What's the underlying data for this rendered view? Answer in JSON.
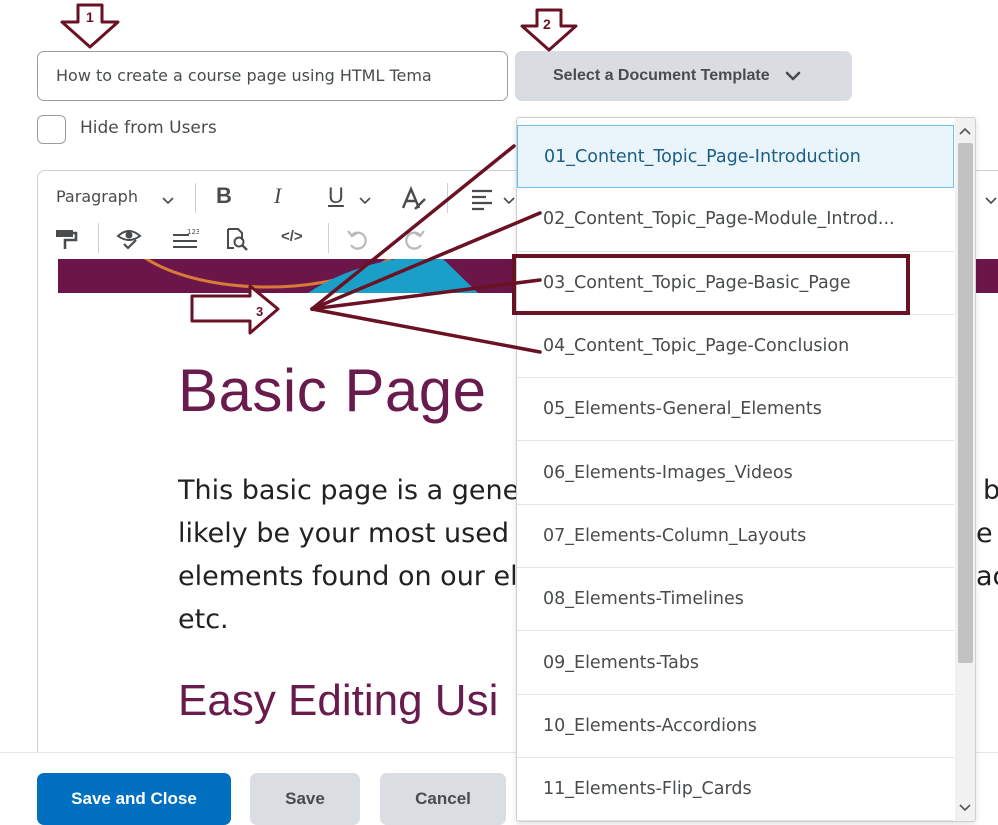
{
  "form": {
    "title_value": "How to create a course page using HTML Tema",
    "template_button_label": "Select a Document Template",
    "hide_label": "Hide from Users"
  },
  "toolbar": {
    "format_select": "Paragraph",
    "bold": "B",
    "italic": "I",
    "underline": "U",
    "code": "</>"
  },
  "content": {
    "heading": "Basic Page",
    "body_lines": [
      "This basic page is a gene",
      "likely be your most used",
      "elements found on our el",
      "etc."
    ],
    "body_right_fragments": [
      "b",
      "e",
      "ac"
    ],
    "subheading": "Easy Editing Usi"
  },
  "footer": {
    "save_close": "Save and Close",
    "save": "Save",
    "cancel": "Cancel"
  },
  "templates": {
    "items": [
      "01_Content_Topic_Page-Introduction",
      "02_Content_Topic_Page-Module_Introd...",
      "03_Content_Topic_Page-Basic_Page",
      "04_Content_Topic_Page-Conclusion",
      "05_Elements-General_Elements",
      "06_Elements-Images_Videos",
      "07_Elements-Column_Layouts",
      "08_Elements-Timelines",
      "09_Elements-Tabs",
      "10_Elements-Accordions",
      "11_Elements-Flip_Cards"
    ],
    "selected_index": 0,
    "highlighted_index": 2
  },
  "annotations": {
    "marker_1": "1",
    "marker_2": "2",
    "marker_3": "3",
    "color": "#6a1224"
  },
  "colors": {
    "brand_heading": "#6a1b4d",
    "primary_button": "#006fbf",
    "secondary_button": "#dadde1",
    "selected_bg": "#e9f5fb"
  }
}
